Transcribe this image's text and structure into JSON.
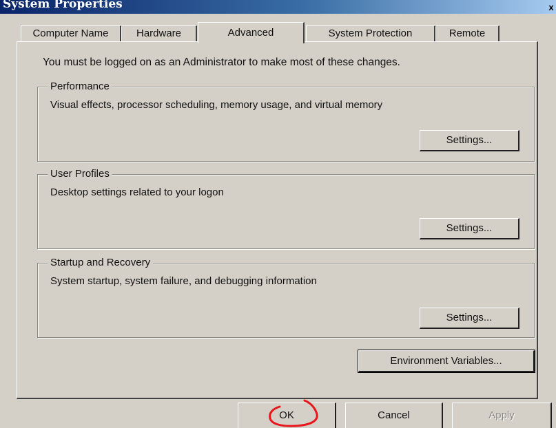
{
  "window": {
    "title": "System Properties",
    "close_glyph": "x"
  },
  "tabs": [
    {
      "label": "Computer Name"
    },
    {
      "label": "Hardware"
    },
    {
      "label": "Advanced",
      "selected": true
    },
    {
      "label": "System Protection"
    },
    {
      "label": "Remote"
    }
  ],
  "note": "You must be logged on as an Administrator to make most of these changes.",
  "groups": {
    "performance": {
      "title": "Performance",
      "description": "Visual effects, processor scheduling, memory usage, and virtual memory",
      "button": "Settings..."
    },
    "user_profiles": {
      "title": "User Profiles",
      "description": "Desktop settings related to your logon",
      "button": "Settings..."
    },
    "startup_recovery": {
      "title": "Startup and Recovery",
      "description": "System startup, system failure, and debugging information",
      "button": "Settings..."
    }
  },
  "env_button": "Environment Variables...",
  "footer": {
    "ok": "OK",
    "cancel": "Cancel",
    "apply": "Apply"
  },
  "annotation": {
    "color": "#e8151b"
  }
}
